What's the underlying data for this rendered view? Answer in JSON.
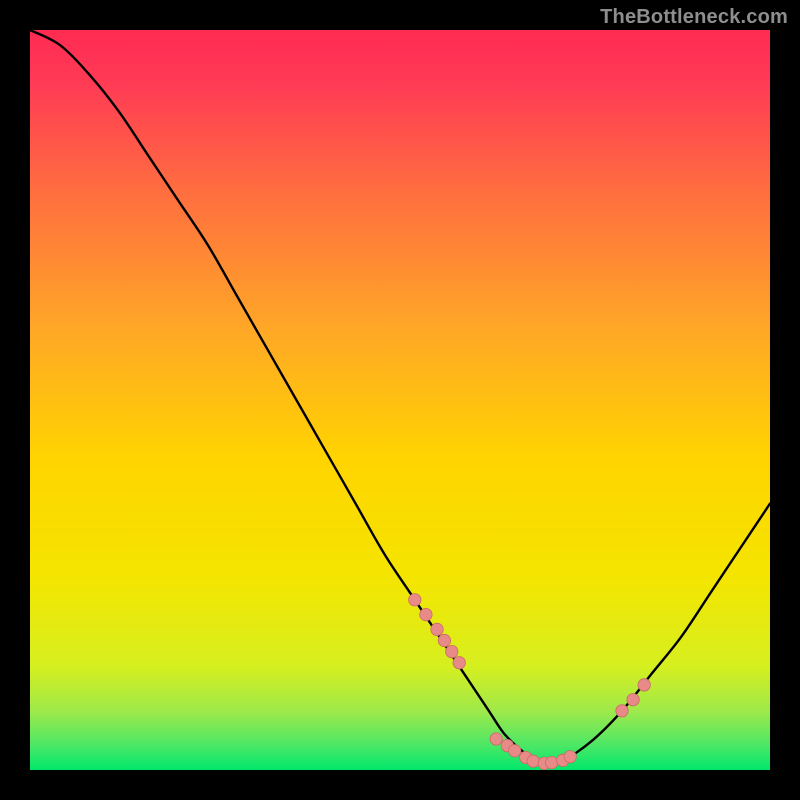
{
  "attribution": "TheBottleneck.com",
  "colors": {
    "gradient_top": "#ff2b52",
    "gradient_mid": "#ffd400",
    "gradient_bottom": "#00e76b",
    "curve": "#000000",
    "marker_fill": "#e88a87",
    "marker_stroke": "#c96a66"
  },
  "chart_data": {
    "type": "line",
    "title": "",
    "xlabel": "",
    "ylabel": "",
    "xlim": [
      0,
      100
    ],
    "ylim": [
      0,
      100
    ],
    "x": [
      0,
      4,
      8,
      12,
      16,
      20,
      24,
      28,
      32,
      36,
      40,
      44,
      48,
      52,
      56,
      60,
      62,
      64,
      66,
      68,
      70,
      72,
      76,
      80,
      84,
      88,
      92,
      96,
      100
    ],
    "values": [
      100,
      98,
      94,
      89,
      83,
      77,
      71,
      64,
      57,
      50,
      43,
      36,
      29,
      23,
      17,
      11,
      8,
      5,
      3,
      1.5,
      0.8,
      1.2,
      4,
      8,
      13,
      18,
      24,
      30,
      36
    ],
    "markers": {
      "x": [
        52,
        53.5,
        55,
        56,
        57,
        58,
        63,
        64.5,
        65.5,
        67,
        68,
        69.5,
        70.5,
        72,
        73,
        80,
        81.5,
        83
      ],
      "y": [
        23,
        21,
        19,
        17.5,
        16,
        14.5,
        4.2,
        3.3,
        2.6,
        1.7,
        1.2,
        0.9,
        1.0,
        1.3,
        1.8,
        8,
        9.5,
        11.5
      ]
    }
  }
}
